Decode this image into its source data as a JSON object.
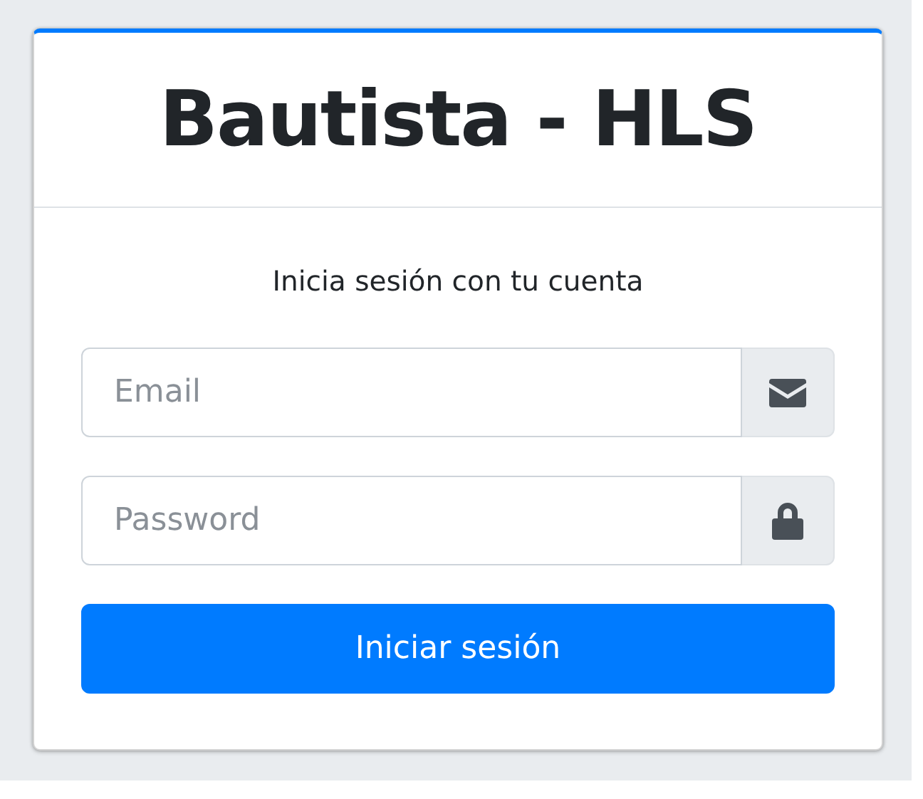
{
  "card": {
    "title": "Bautista - HLS",
    "message": "Inicia sesión con tu cuenta",
    "fields": [
      {
        "kind": "email",
        "placeholder": "Email"
      },
      {
        "kind": "password",
        "placeholder": "Password"
      }
    ],
    "button": "Iniciar sesión"
  }
}
